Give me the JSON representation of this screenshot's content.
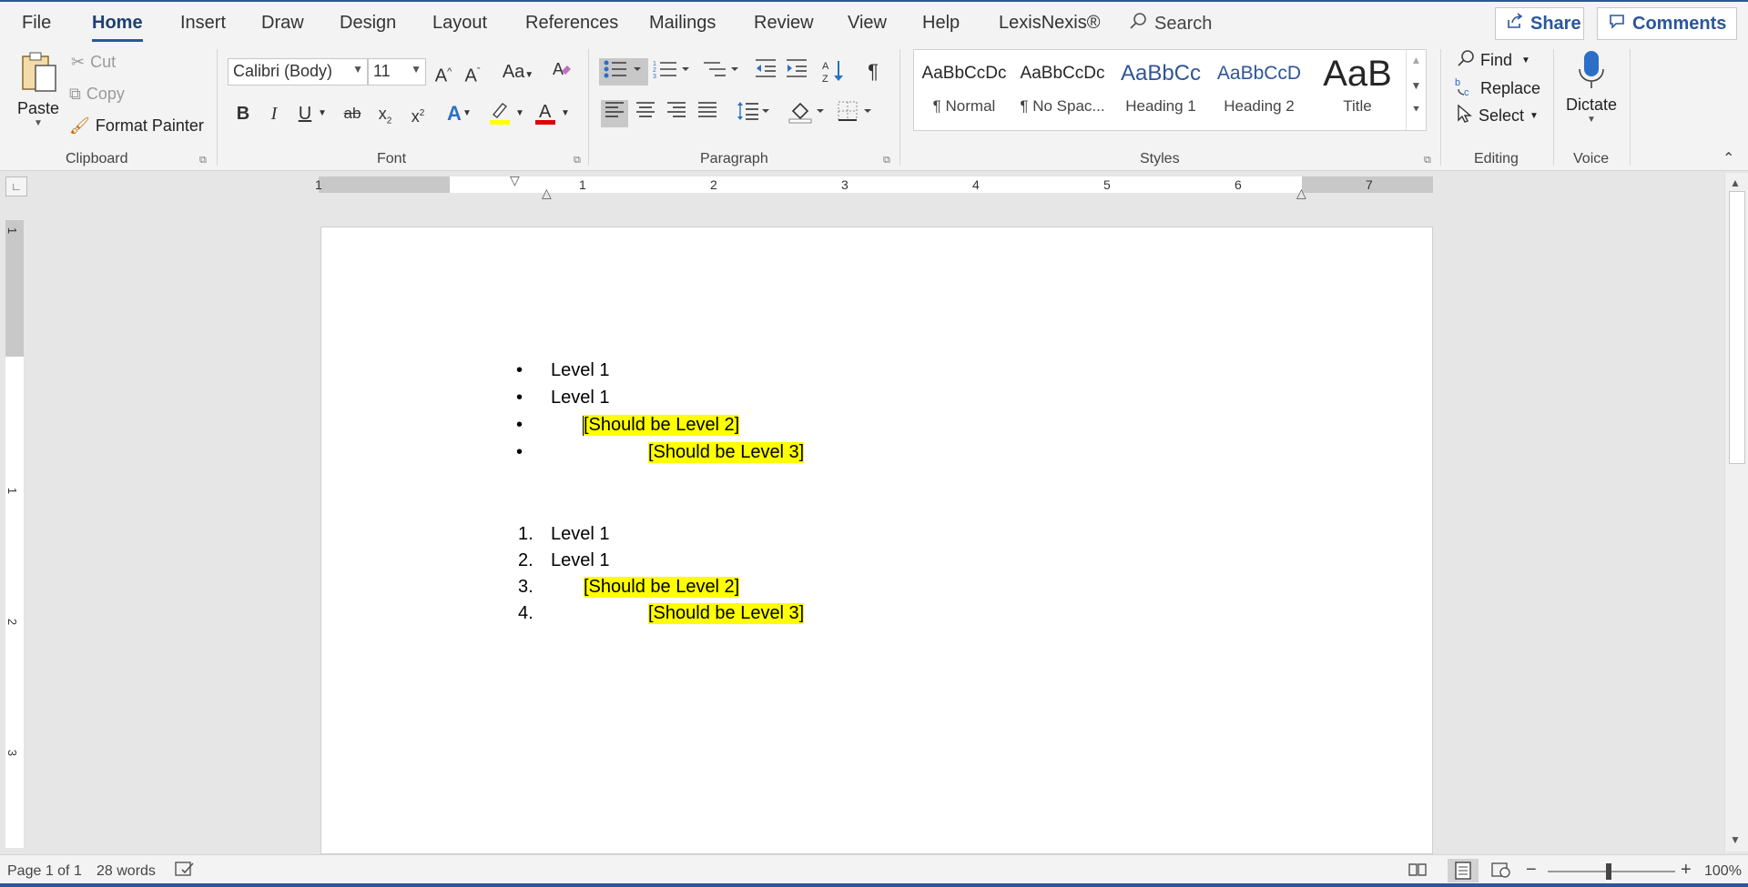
{
  "tabs": [
    "File",
    "Home",
    "Insert",
    "Draw",
    "Design",
    "Layout",
    "References",
    "Mailings",
    "Review",
    "View",
    "Help",
    "LexisNexis®"
  ],
  "active_tab": "Home",
  "search_label": "Search",
  "share_label": "Share",
  "comments_label": "Comments",
  "clipboard": {
    "paste": "Paste",
    "cut": "Cut",
    "copy": "Copy",
    "format_painter": "Format Painter",
    "group_label": "Clipboard"
  },
  "font": {
    "name": "Calibri (Body)",
    "size": "11",
    "group_label": "Font",
    "change_case": "Aa"
  },
  "paragraph": {
    "group_label": "Paragraph"
  },
  "styles": {
    "group_label": "Styles",
    "items": [
      {
        "preview": "AaBbCcDc",
        "name": "¶ Normal"
      },
      {
        "preview": "AaBbCcDc",
        "name": "¶ No Spac..."
      },
      {
        "preview": "AaBbCc",
        "name": "Heading 1"
      },
      {
        "preview": "AaBbCcD",
        "name": "Heading 2"
      },
      {
        "preview": "AaB",
        "name": "Title"
      }
    ]
  },
  "editing": {
    "group_label": "Editing",
    "find": "Find",
    "replace": "Replace",
    "select": "Select"
  },
  "voice": {
    "group_label": "Voice",
    "dictate": "Dictate"
  },
  "ruler_numbers": [
    "1",
    "1",
    "2",
    "3",
    "4",
    "5",
    "6",
    "7"
  ],
  "vruler_numbers": [
    "1",
    "1",
    "2",
    "3"
  ],
  "document": {
    "bullets": [
      {
        "marker": "•",
        "text": "Level 1",
        "highlight": false
      },
      {
        "marker": "•",
        "text": "Level 1",
        "highlight": false
      },
      {
        "marker": "•",
        "text": "[Should be Level 2]",
        "highlight": true
      },
      {
        "marker": "•",
        "text": "[Should be Level 3]",
        "highlight": true
      }
    ],
    "numbered": [
      {
        "marker": "1.",
        "text": "Level 1",
        "highlight": false
      },
      {
        "marker": "2.",
        "text": "Level 1",
        "highlight": false
      },
      {
        "marker": "3.",
        "text": "[Should be Level 2]",
        "highlight": true
      },
      {
        "marker": "4.",
        "text": "[Should be Level 3]",
        "highlight": true
      }
    ]
  },
  "status": {
    "page": "Page 1 of 1",
    "words": "28 words",
    "zoom": "100%"
  },
  "colors": {
    "accent": "#2b579a",
    "highlight": "#ffff00",
    "font_color": "#e00000"
  }
}
